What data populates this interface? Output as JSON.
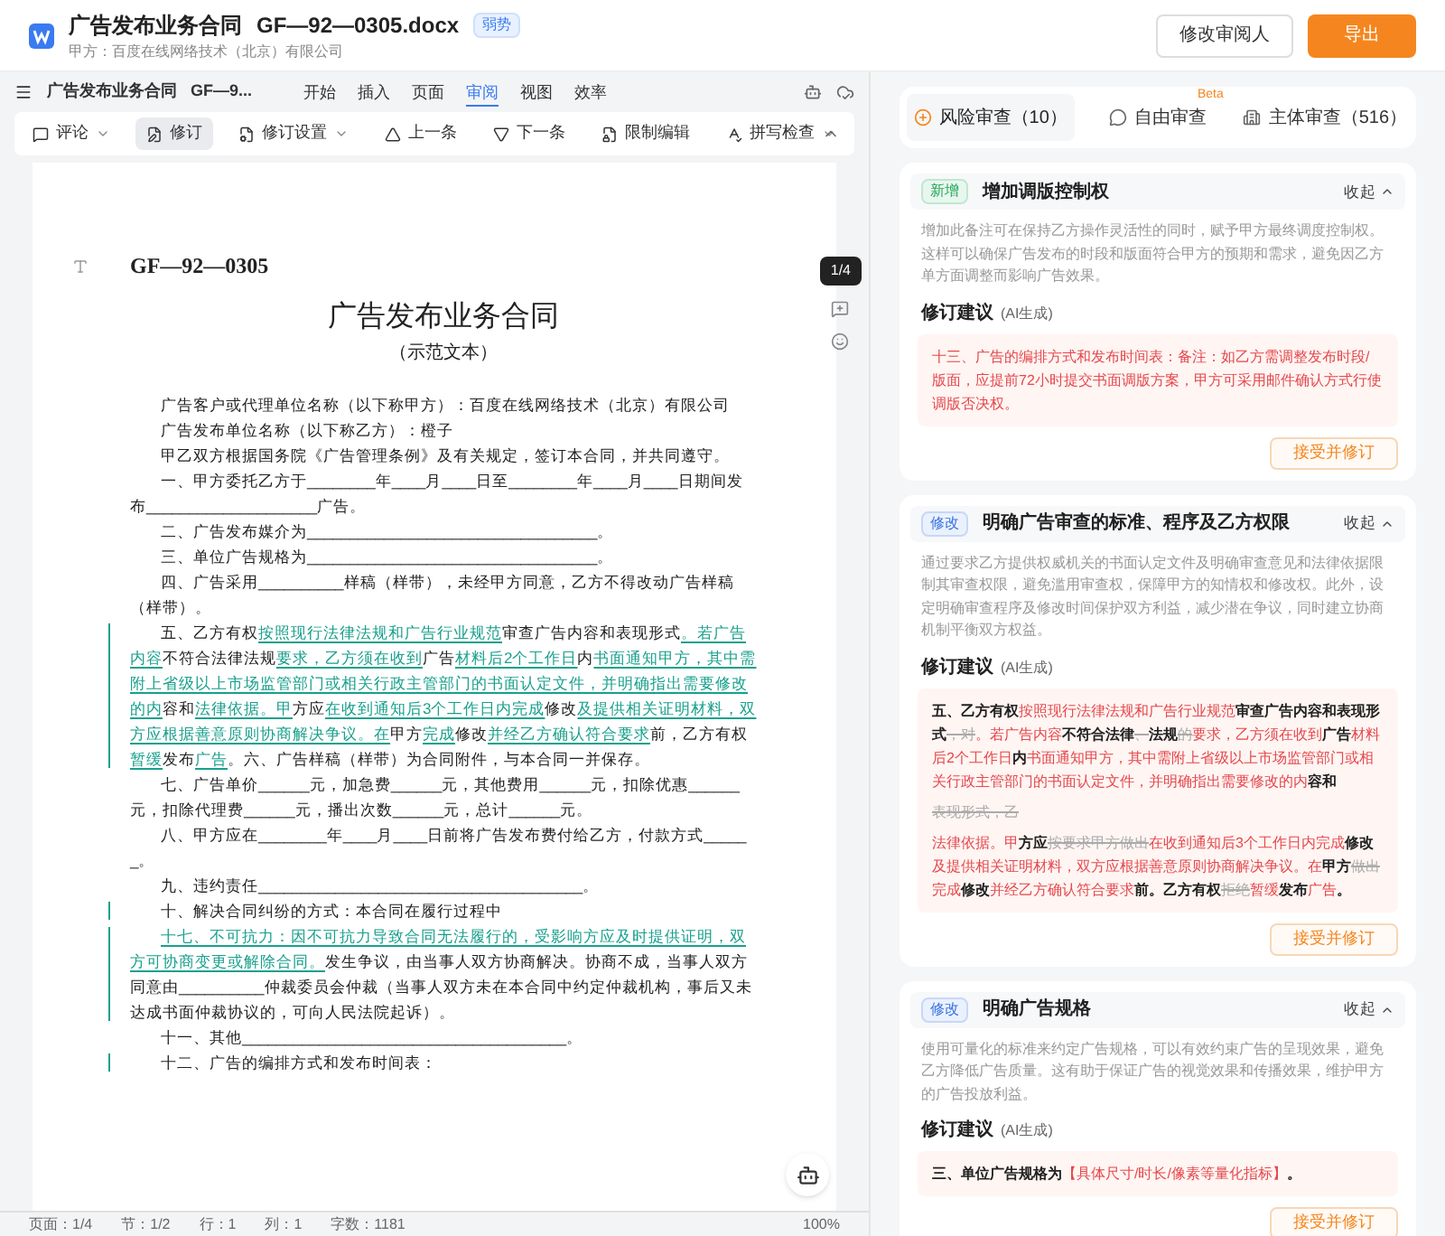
{
  "header": {
    "title": "广告发布业务合同",
    "filename": "GF—92—0305.docx",
    "badge": "弱势",
    "subtitle": "甲方：百度在线网络技术（北京）有限公司",
    "buttons": [
      {
        "label": "修改审阅人",
        "kind": "secondary"
      },
      {
        "label": "导出",
        "kind": "primary"
      }
    ]
  },
  "editor": {
    "doc_name": "广告发布业务合同   GF—9...",
    "menu": [
      {
        "label": "开始",
        "selected": false
      },
      {
        "label": "插入",
        "selected": false
      },
      {
        "label": "页面",
        "selected": false
      },
      {
        "label": "审阅",
        "selected": true
      },
      {
        "label": "视图",
        "selected": false
      },
      {
        "label": "效率",
        "selected": false
      }
    ],
    "toolbar": [
      {
        "label": "评论",
        "active": false,
        "dropdown": true
      },
      {
        "label": "修订",
        "active": true,
        "dropdown": false
      },
      {
        "label": "修订设置",
        "active": false,
        "dropdown": true
      },
      {
        "label": "上一条",
        "active": false,
        "dropdown": false
      },
      {
        "label": "下一条",
        "active": false,
        "dropdown": false
      },
      {
        "label": "限制编辑",
        "active": false,
        "dropdown": false
      },
      {
        "label": "拼写检查",
        "active": false,
        "dropdown": true
      }
    ]
  },
  "page": {
    "code": "GF—92—0305",
    "title": "广告发布业务合同",
    "subtitle": "（示范文本）",
    "paragraphs": [
      {
        "changed": false,
        "segments": [
          {
            "text": "广告客户或代理单位名称（以下称甲方）：百度在线网络技术（北京）有限公司",
            "kind": "plain"
          }
        ]
      },
      {
        "changed": false,
        "segments": [
          {
            "text": "广告发布单位名称（以下称乙方）：橙子",
            "kind": "plain"
          }
        ]
      },
      {
        "changed": false,
        "segments": [
          {
            "text": "甲乙双方根据国务院《广告管理条例》及有关规定，签订本合同，并共同遵守。",
            "kind": "plain"
          }
        ]
      },
      {
        "changed": false,
        "segments": [
          {
            "text": "一、甲方委托乙方于________年____月____日至________年____月____日期间发布____________________广告。",
            "kind": "plain"
          }
        ]
      },
      {
        "changed": false,
        "segments": [
          {
            "text": "二、广告发布媒介为__________________________________。",
            "kind": "plain"
          }
        ]
      },
      {
        "changed": false,
        "segments": [
          {
            "text": "三、单位广告规格为__________________________________。",
            "kind": "plain"
          }
        ]
      },
      {
        "changed": false,
        "segments": [
          {
            "text": "四、广告采用__________样稿（样带），未经甲方同意，乙方不得改动广告样稿（样带）。",
            "kind": "plain"
          }
        ]
      },
      {
        "changed": true,
        "segments": [
          {
            "text": "五、乙方有权",
            "kind": "plain"
          },
          {
            "text": "按照现行法律法规和广告行业规范",
            "kind": "insert"
          },
          {
            "text": "审查广告内容和表现形式",
            "kind": "plain"
          },
          {
            "text": "。若广告内容",
            "kind": "insert"
          },
          {
            "text": "不符合法律法规",
            "kind": "plain"
          },
          {
            "text": "要求，乙方须在收到",
            "kind": "insert"
          },
          {
            "text": "广告",
            "kind": "plain"
          },
          {
            "text": "材料后2个工作日",
            "kind": "insert"
          },
          {
            "text": "内",
            "kind": "plain"
          },
          {
            "text": "书面通知甲方，其中需附上省级以上市场监管部门或相关行政主管部门的书面认定文件，并明确指出需要修改的内",
            "kind": "insert"
          },
          {
            "text": "容和",
            "kind": "plain"
          },
          {
            "text": "法律依据。甲",
            "kind": "insert"
          },
          {
            "text": "方应",
            "kind": "plain"
          },
          {
            "text": "在收到通知后3个工作日内完成",
            "kind": "insert"
          },
          {
            "text": "修改",
            "kind": "plain"
          },
          {
            "text": "及提供相关证明材料，双方应根据善意原则协商解决争议。在",
            "kind": "insert"
          },
          {
            "text": "甲方",
            "kind": "plain"
          },
          {
            "text": "完成",
            "kind": "insert"
          },
          {
            "text": "修改",
            "kind": "plain"
          },
          {
            "text": "并经乙方确认符合要求",
            "kind": "insert"
          },
          {
            "text": "前，乙方有权",
            "kind": "plain"
          },
          {
            "text": "暂缓",
            "kind": "insert"
          },
          {
            "text": "发布",
            "kind": "plain"
          },
          {
            "text": "广告",
            "kind": "insert"
          },
          {
            "text": "。六、广告样稿（样带）为合同附件，与本合同一并保存。",
            "kind": "plain"
          }
        ]
      },
      {
        "changed": false,
        "segments": [
          {
            "text": "七、广告单价______元，加急费______元，其他费用______元，扣除优惠______元，扣除代理费______元，播出次数______元，总计______元。",
            "kind": "plain"
          }
        ]
      },
      {
        "changed": false,
        "segments": [
          {
            "text": "八、甲方应在________年____月____日前将广告发布费付给乙方，付款方式______。",
            "kind": "plain"
          }
        ]
      },
      {
        "changed": false,
        "segments": [
          {
            "text": "九、违约责任______________________________________。",
            "kind": "plain"
          }
        ]
      },
      {
        "changed": true,
        "segments": [
          {
            "text": "十、解决合同纠纷的方式：本合同在履行过程中",
            "kind": "plain"
          }
        ]
      },
      {
        "changed": true,
        "segments": [
          {
            "text": "十七、不可抗力：因不可抗力导致合同无法履行的，受影响方应及时提供证明，双方可协商变更或解除合同。",
            "kind": "insert"
          },
          {
            "text": "发生争议，由当事人双方协商解决。协商不成，当事人双方同意由__________仲裁委员会仲裁（当事人双方未在本合同中约定仲裁机构，事后又未达成书面仲裁协议的，可向人民法院起诉）。",
            "kind": "plain"
          }
        ]
      },
      {
        "changed": false,
        "segments": [
          {
            "text": "十一、其他______________________________________。",
            "kind": "plain"
          }
        ]
      },
      {
        "changed": true,
        "segments": [
          {
            "text": "十二、广告的编排方式和发布时间表：",
            "kind": "plain"
          }
        ]
      }
    ]
  },
  "page_indicator": "1/4",
  "status_bar": [
    "页面：1/4",
    "节：1/2",
    "行：1",
    "列：1",
    "字数：1181",
    "100%"
  ],
  "review": {
    "tabs": [
      {
        "label": "风险审查（10）",
        "selected": true
      },
      {
        "label": "自由审查",
        "selected": false,
        "badge": "Beta"
      },
      {
        "label": "主体审查（516）",
        "selected": false
      }
    ],
    "cards": [
      {
        "tag": {
          "label": "新增",
          "kind": "new"
        },
        "title": "增加调版控制权",
        "collapse": "收起",
        "description": "增加此备注可在保持乙方操作灵活性的同时，赋予甲方最终调度控制权。这样可以确保广告发布的时段和版面符合甲方的预期和需求，避免因乙方单方面调整而影响广告效果。",
        "suggestion_label": "修订建议",
        "suggestion_note": "(AI生成)",
        "suggestion": [
          [
            {
              "text": "十三、广告的编排方式和发布时间表：备注：如乙方需调整发布时段/版面，应提前72小时提交书面调版方案，甲方可采用邮件确认方式行使调版否决权。",
              "kind": "add"
            }
          ]
        ],
        "button": "接受并修订"
      },
      {
        "tag": {
          "label": "修改",
          "kind": "modify"
        },
        "title": "明确广告审查的标准、程序及乙方权限",
        "collapse": "收起",
        "description": "通过要求乙方提供权威机关的书面认定文件及明确审查意见和法律依据限制其审查权限，避免滥用审查权，保障甲方的知情权和修改权。此外，设定明确审查程序及修改时间保护双方利益，减少潜在争议，同时建立协商机制平衡双方权益。",
        "suggestion_label": "修订建议",
        "suggestion_note": "(AI生成)",
        "suggestion": [
          [
            {
              "text": "五、乙方有权",
              "kind": "keep"
            },
            {
              "text": "按照现行法律法规和广告行业规范",
              "kind": "add"
            },
            {
              "text": "审查广告内容和表现形式",
              "kind": "keep"
            },
            {
              "text": "，对",
              "kind": "del"
            },
            {
              "text": "。若广告内容",
              "kind": "add"
            },
            {
              "text": "不符合法律",
              "kind": "keep"
            },
            {
              "text": "、",
              "kind": "del"
            },
            {
              "text": "法规",
              "kind": "keep"
            },
            {
              "text": "的",
              "kind": "del"
            },
            {
              "text": "要求，乙方须在收到",
              "kind": "add"
            },
            {
              "text": "广告",
              "kind": "keep"
            },
            {
              "text": "材料后2个工作日",
              "kind": "add"
            },
            {
              "text": "内",
              "kind": "keep"
            },
            {
              "text": "书面通知甲方，其中需附上省级以上市场监管部门或相关行政主管部门的书面认定文件，并明确指出需要修改的内",
              "kind": "add"
            },
            {
              "text": "容和",
              "kind": "keep"
            }
          ],
          [
            {
              "text": "表现形式，乙",
              "kind": "del"
            }
          ],
          [
            {
              "text": "法律依据。甲",
              "kind": "add"
            },
            {
              "text": "方应",
              "kind": "keep"
            },
            {
              "text": "按要求甲方做出",
              "kind": "del"
            },
            {
              "text": "在收到通知后3个工作日内完成",
              "kind": "add"
            },
            {
              "text": "修改",
              "kind": "keep"
            },
            {
              "text": "及提供相关证明材料，双方应根据善意原则协商解决争议。在",
              "kind": "add"
            },
            {
              "text": "甲方",
              "kind": "keep"
            },
            {
              "text": "做出",
              "kind": "del"
            },
            {
              "text": "完成",
              "kind": "add"
            },
            {
              "text": "修改",
              "kind": "keep"
            },
            {
              "text": "并经乙方确认符合要求",
              "kind": "add"
            },
            {
              "text": "前。乙方有权",
              "kind": "keep"
            },
            {
              "text": "拒绝",
              "kind": "del"
            },
            {
              "text": "暂缓",
              "kind": "add"
            },
            {
              "text": "发布",
              "kind": "keep"
            },
            {
              "text": "广告",
              "kind": "add"
            },
            {
              "text": "。",
              "kind": "keep"
            }
          ]
        ],
        "button": "接受并修订"
      },
      {
        "tag": {
          "label": "修改",
          "kind": "modify"
        },
        "title": "明确广告规格",
        "collapse": "收起",
        "description": "使用可量化的标准来约定广告规格，可以有效约束广告的呈现效果，避免乙方降低广告质量。这有助于保证广告的视觉效果和传播效果，维护甲方的广告投放利益。",
        "suggestion_label": "修订建议",
        "suggestion_note": "(AI生成)",
        "suggestion": [
          [
            {
              "text": "三、单位广告规格为",
              "kind": "keep"
            },
            {
              "text": "【具体尺寸/时长/像素等量化指标】",
              "kind": "add"
            },
            {
              "text": "。",
              "kind": "keep"
            }
          ]
        ],
        "button": "接受并修订"
      }
    ]
  }
}
